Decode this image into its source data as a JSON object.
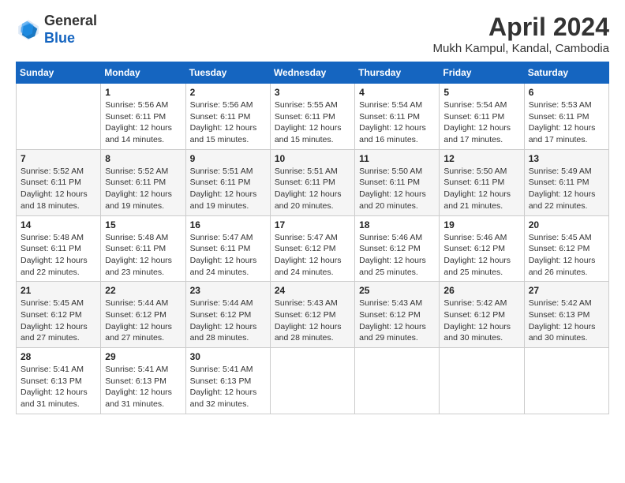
{
  "logo": {
    "line1": "General",
    "line2": "Blue"
  },
  "title": "April 2024",
  "subtitle": "Mukh Kampul, Kandal, Cambodia",
  "days_header": [
    "Sunday",
    "Monday",
    "Tuesday",
    "Wednesday",
    "Thursday",
    "Friday",
    "Saturday"
  ],
  "weeks": [
    [
      {
        "day": "",
        "info": ""
      },
      {
        "day": "1",
        "info": "Sunrise: 5:56 AM\nSunset: 6:11 PM\nDaylight: 12 hours\nand 14 minutes."
      },
      {
        "day": "2",
        "info": "Sunrise: 5:56 AM\nSunset: 6:11 PM\nDaylight: 12 hours\nand 15 minutes."
      },
      {
        "day": "3",
        "info": "Sunrise: 5:55 AM\nSunset: 6:11 PM\nDaylight: 12 hours\nand 15 minutes."
      },
      {
        "day": "4",
        "info": "Sunrise: 5:54 AM\nSunset: 6:11 PM\nDaylight: 12 hours\nand 16 minutes."
      },
      {
        "day": "5",
        "info": "Sunrise: 5:54 AM\nSunset: 6:11 PM\nDaylight: 12 hours\nand 17 minutes."
      },
      {
        "day": "6",
        "info": "Sunrise: 5:53 AM\nSunset: 6:11 PM\nDaylight: 12 hours\nand 17 minutes."
      }
    ],
    [
      {
        "day": "7",
        "info": "Sunrise: 5:52 AM\nSunset: 6:11 PM\nDaylight: 12 hours\nand 18 minutes."
      },
      {
        "day": "8",
        "info": "Sunrise: 5:52 AM\nSunset: 6:11 PM\nDaylight: 12 hours\nand 19 minutes."
      },
      {
        "day": "9",
        "info": "Sunrise: 5:51 AM\nSunset: 6:11 PM\nDaylight: 12 hours\nand 19 minutes."
      },
      {
        "day": "10",
        "info": "Sunrise: 5:51 AM\nSunset: 6:11 PM\nDaylight: 12 hours\nand 20 minutes."
      },
      {
        "day": "11",
        "info": "Sunrise: 5:50 AM\nSunset: 6:11 PM\nDaylight: 12 hours\nand 20 minutes."
      },
      {
        "day": "12",
        "info": "Sunrise: 5:50 AM\nSunset: 6:11 PM\nDaylight: 12 hours\nand 21 minutes."
      },
      {
        "day": "13",
        "info": "Sunrise: 5:49 AM\nSunset: 6:11 PM\nDaylight: 12 hours\nand 22 minutes."
      }
    ],
    [
      {
        "day": "14",
        "info": "Sunrise: 5:48 AM\nSunset: 6:11 PM\nDaylight: 12 hours\nand 22 minutes."
      },
      {
        "day": "15",
        "info": "Sunrise: 5:48 AM\nSunset: 6:11 PM\nDaylight: 12 hours\nand 23 minutes."
      },
      {
        "day": "16",
        "info": "Sunrise: 5:47 AM\nSunset: 6:11 PM\nDaylight: 12 hours\nand 24 minutes."
      },
      {
        "day": "17",
        "info": "Sunrise: 5:47 AM\nSunset: 6:12 PM\nDaylight: 12 hours\nand 24 minutes."
      },
      {
        "day": "18",
        "info": "Sunrise: 5:46 AM\nSunset: 6:12 PM\nDaylight: 12 hours\nand 25 minutes."
      },
      {
        "day": "19",
        "info": "Sunrise: 5:46 AM\nSunset: 6:12 PM\nDaylight: 12 hours\nand 25 minutes."
      },
      {
        "day": "20",
        "info": "Sunrise: 5:45 AM\nSunset: 6:12 PM\nDaylight: 12 hours\nand 26 minutes."
      }
    ],
    [
      {
        "day": "21",
        "info": "Sunrise: 5:45 AM\nSunset: 6:12 PM\nDaylight: 12 hours\nand 27 minutes."
      },
      {
        "day": "22",
        "info": "Sunrise: 5:44 AM\nSunset: 6:12 PM\nDaylight: 12 hours\nand 27 minutes."
      },
      {
        "day": "23",
        "info": "Sunrise: 5:44 AM\nSunset: 6:12 PM\nDaylight: 12 hours\nand 28 minutes."
      },
      {
        "day": "24",
        "info": "Sunrise: 5:43 AM\nSunset: 6:12 PM\nDaylight: 12 hours\nand 28 minutes."
      },
      {
        "day": "25",
        "info": "Sunrise: 5:43 AM\nSunset: 6:12 PM\nDaylight: 12 hours\nand 29 minutes."
      },
      {
        "day": "26",
        "info": "Sunrise: 5:42 AM\nSunset: 6:12 PM\nDaylight: 12 hours\nand 30 minutes."
      },
      {
        "day": "27",
        "info": "Sunrise: 5:42 AM\nSunset: 6:13 PM\nDaylight: 12 hours\nand 30 minutes."
      }
    ],
    [
      {
        "day": "28",
        "info": "Sunrise: 5:41 AM\nSunset: 6:13 PM\nDaylight: 12 hours\nand 31 minutes."
      },
      {
        "day": "29",
        "info": "Sunrise: 5:41 AM\nSunset: 6:13 PM\nDaylight: 12 hours\nand 31 minutes."
      },
      {
        "day": "30",
        "info": "Sunrise: 5:41 AM\nSunset: 6:13 PM\nDaylight: 12 hours\nand 32 minutes."
      },
      {
        "day": "",
        "info": ""
      },
      {
        "day": "",
        "info": ""
      },
      {
        "day": "",
        "info": ""
      },
      {
        "day": "",
        "info": ""
      }
    ]
  ]
}
